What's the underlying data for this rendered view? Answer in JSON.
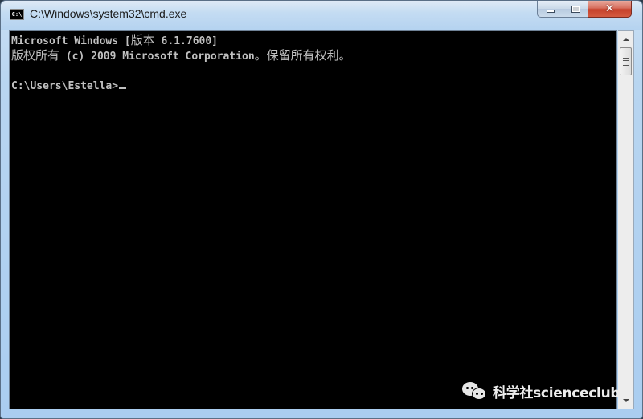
{
  "window": {
    "title": "C:\\Windows\\system32\\cmd.exe",
    "app_icon_label": "C:\\",
    "icons": {
      "app": "cmd-icon",
      "minimize": "minimize-icon",
      "maximize": "maximize-icon",
      "close": "close-icon"
    },
    "close_glyph": "✕"
  },
  "console": {
    "lines": [
      {
        "parts": [
          {
            "text": "Microsoft Windows [",
            "cjk": false
          },
          {
            "text": "版本",
            "cjk": true
          },
          {
            "text": " 6.1.7600]",
            "cjk": false
          }
        ]
      },
      {
        "parts": [
          {
            "text": "版权所有",
            "cjk": true
          },
          {
            "text": " (c) 2009 Microsoft Corporation",
            "cjk": false
          },
          {
            "text": "。保留所有权利。",
            "cjk": true
          }
        ]
      },
      {
        "parts": [
          {
            "text": "",
            "cjk": false
          }
        ]
      },
      {
        "parts": [
          {
            "text": "C:\\Users\\Estella>",
            "cjk": false
          }
        ]
      }
    ],
    "prompt": "C:\\Users\\Estella>",
    "colors": {
      "background": "#000000",
      "foreground": "#c0c0c0"
    }
  },
  "watermark": {
    "icon": "wechat-icon",
    "text": "科学社scienceclub"
  },
  "colors": {
    "frame": "#b8d5f0",
    "close_button": "#c6412b"
  }
}
